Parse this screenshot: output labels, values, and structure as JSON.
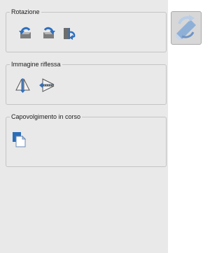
{
  "groups": {
    "rotation": {
      "title": "Rotazione",
      "buttons": [
        {
          "icon": "rotate-left-icon"
        },
        {
          "icon": "rotate-right-icon"
        },
        {
          "icon": "rotate-180-icon"
        }
      ]
    },
    "mirror": {
      "title": "Immagine riflessa",
      "buttons": [
        {
          "icon": "flip-horizontal-icon"
        },
        {
          "icon": "flip-vertical-icon"
        }
      ]
    },
    "flip_progress": {
      "title": "Capovolgimento in corso",
      "buttons": [
        {
          "icon": "flip-page-icon"
        }
      ]
    }
  },
  "side_button": {
    "icon": "rotate-tool-icon"
  },
  "colors": {
    "accent_blue": "#2d6fc0",
    "panel_bg": "#e9e9e9",
    "border": "#c4c4c4"
  }
}
